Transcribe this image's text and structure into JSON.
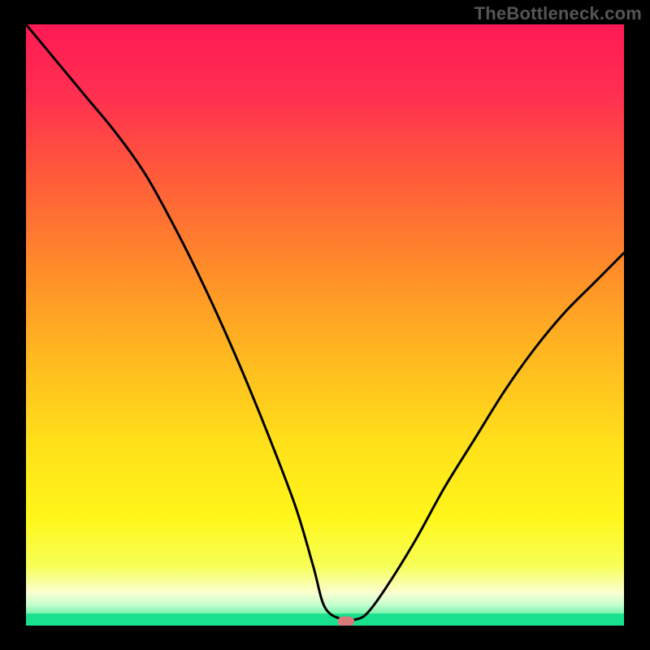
{
  "watermark": "TheBottleneck.com",
  "chart_data": {
    "type": "line",
    "title": "",
    "xlabel": "",
    "ylabel": "",
    "xlim": [
      0,
      100
    ],
    "ylim": [
      0,
      100
    ],
    "grid": false,
    "legend": false,
    "series": [
      {
        "name": "curve",
        "x": [
          0,
          5,
          10,
          15,
          20,
          25,
          30,
          35,
          40,
          45,
          48,
          50,
          53,
          55,
          57,
          60,
          65,
          70,
          75,
          80,
          85,
          90,
          95,
          100
        ],
        "values": [
          100,
          94,
          88,
          82,
          75,
          66,
          56,
          45,
          33,
          20,
          10,
          3,
          1,
          1,
          2,
          6,
          14,
          23,
          31,
          39,
          46,
          52,
          57,
          62
        ]
      }
    ],
    "baseline_band": {
      "y_from": 0.0,
      "y_to": 2.0,
      "color_top": "#2bd97f",
      "color_bottom": "#18e08c"
    },
    "marker": {
      "x": 53.5,
      "y": 0.7,
      "width": 2.8,
      "height": 1.6,
      "radius": 0.9,
      "color": "#d97a7a"
    },
    "background_gradient": {
      "stops": [
        {
          "offset": 0.0,
          "color": "#ff1a55"
        },
        {
          "offset": 0.12,
          "color": "#ff3050"
        },
        {
          "offset": 0.25,
          "color": "#ff5a3a"
        },
        {
          "offset": 0.4,
          "color": "#ff8a2a"
        },
        {
          "offset": 0.55,
          "color": "#ffb820"
        },
        {
          "offset": 0.7,
          "color": "#ffe11a"
        },
        {
          "offset": 0.82,
          "color": "#fff61a"
        },
        {
          "offset": 0.9,
          "color": "#f7ff55"
        },
        {
          "offset": 0.945,
          "color": "#faffd0"
        },
        {
          "offset": 0.965,
          "color": "#c7ffd0"
        },
        {
          "offset": 0.985,
          "color": "#5ff0a0"
        },
        {
          "offset": 1.0,
          "color": "#18e08c"
        }
      ]
    },
    "stroke": {
      "color": "#000000",
      "width": 3
    }
  }
}
